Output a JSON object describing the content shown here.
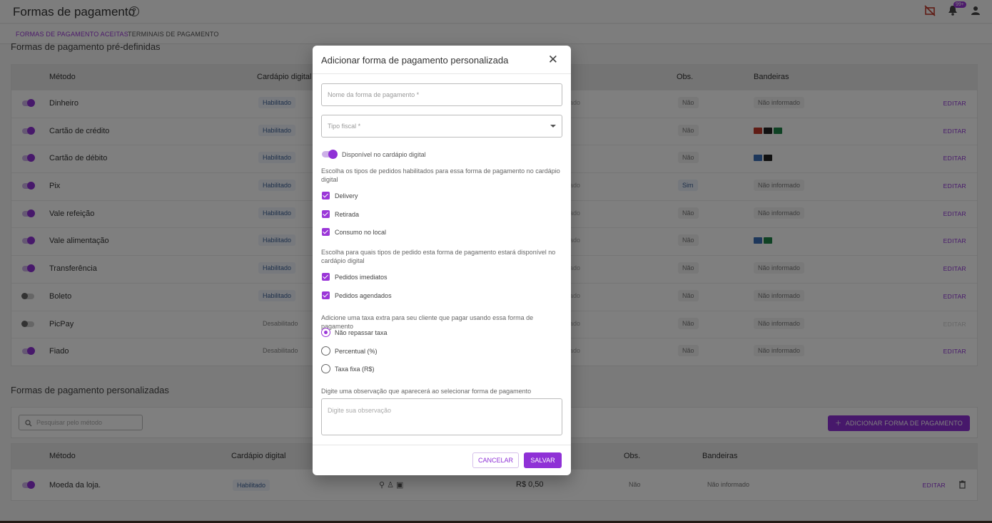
{
  "header": {
    "title": "Formas de pagamento",
    "notifications_badge": "99+"
  },
  "tabs": [
    {
      "label": "FORMAS DE PAGAMENTO ACEITAS",
      "active": true
    },
    {
      "label": "TERMINAIS DE PAGAMENTO",
      "active": false
    }
  ],
  "predefined": {
    "title": "Formas de pagamento pré-definidas",
    "columns": {
      "method": "Método",
      "digital_menu": "Cardápio digital",
      "obs": "Obs.",
      "flags": "Bandeiras"
    },
    "rows": [
      {
        "method": "Dinheiro",
        "status": "Habilitado",
        "enabled": true,
        "mid": "ado",
        "obs": "Não",
        "flags": "Não informado",
        "flag_icons": []
      },
      {
        "method": "Cartão de crédito",
        "status": "Habilitado",
        "enabled": true,
        "mid": "",
        "obs": "Não",
        "flags": "",
        "flag_icons": [
          "#c0392b",
          "#222222",
          "#1e8449"
        ]
      },
      {
        "method": "Cartão de débito",
        "status": "Habilitado",
        "enabled": true,
        "mid": "",
        "obs": "Não",
        "flags": "",
        "flag_icons": [
          "#3b6fb6",
          "#222222"
        ]
      },
      {
        "method": "Pix",
        "status": "Habilitado",
        "enabled": true,
        "mid": "ado",
        "obs": "Sim",
        "flags": "Não informado",
        "flag_icons": []
      },
      {
        "method": "Vale refeição",
        "status": "Habilitado",
        "enabled": true,
        "mid": "ado",
        "obs": "Não",
        "flags": "Não informado",
        "flag_icons": []
      },
      {
        "method": "Vale alimentação",
        "status": "Habilitado",
        "enabled": true,
        "mid": "ado",
        "obs": "Não",
        "flags": "",
        "flag_icons": [
          "#3b6fb6",
          "#1e8449"
        ]
      },
      {
        "method": "Transferência",
        "status": "Habilitado",
        "enabled": true,
        "mid": "ado",
        "obs": "Não",
        "flags": "Não informado",
        "flag_icons": []
      },
      {
        "method": "Boleto",
        "status": "Habilitado",
        "enabled": false,
        "mid": "ado",
        "obs": "Não",
        "flags": "Não informado",
        "flag_icons": []
      },
      {
        "method": "PicPay",
        "status": "Desabilitado",
        "enabled": false,
        "mid": "ado",
        "obs": "Não",
        "flags": "Não informado",
        "flag_icons": []
      },
      {
        "method": "Fiado",
        "status": "Desabilitado",
        "enabled": true,
        "mid": "ado",
        "obs": "Não",
        "flags": "Não informado",
        "flag_icons": []
      }
    ],
    "edit_label": "EDITAR"
  },
  "custom": {
    "title": "Formas de pagamento personalizadas",
    "search_placeholder": "Pesquisar pelo método",
    "add_button": "ADICIONAR FORMA DE PAGAMENTO",
    "columns": {
      "method": "Método",
      "digital_menu": "Cardápio digital",
      "obs": "Obs.",
      "flags": "Bandeiras"
    },
    "rows": [
      {
        "method": "Moeda da loja.",
        "status": "Habilitado",
        "fee": "R$ 0,50",
        "obs": "Não",
        "flags": "Não informado"
      }
    ],
    "edit_label": "EDITAR"
  },
  "modal": {
    "title": "Adicionar forma de pagamento personalizada",
    "name_placeholder": "Nome da forma de pagamento *",
    "fiscal_placeholder": "Tipo fiscal *",
    "available_toggle": "Disponível no cardápio digital",
    "order_types_hint": "Escolha os tipos de pedidos habilitados para essa forma de pagamento no cardápio digital",
    "order_types": [
      "Delivery",
      "Retirada",
      "Consumo no local"
    ],
    "schedule_hint": "Escolha para quais tipos de pedido esta forma de pagamento estará disponível no cardápio digital",
    "schedule_types": [
      "Pedidos imediatos",
      "Pedidos agendados"
    ],
    "fee_hint": "Adicione uma taxa extra para seu cliente que pagar usando essa forma de pagamento",
    "fee_options": [
      "Não repassar taxa",
      "Percentual (%)",
      "Taxa fixa (R$)"
    ],
    "fee_selected": 0,
    "obs_hint": "Digite uma observação que aparecerá ao selecionar forma de pagamento",
    "obs_placeholder": "Digite sua observação",
    "cancel": "CANCELAR",
    "save": "SALVAR"
  },
  "colors": {
    "accent": "#8f31d6",
    "chip_bg": "#eef3fb"
  }
}
